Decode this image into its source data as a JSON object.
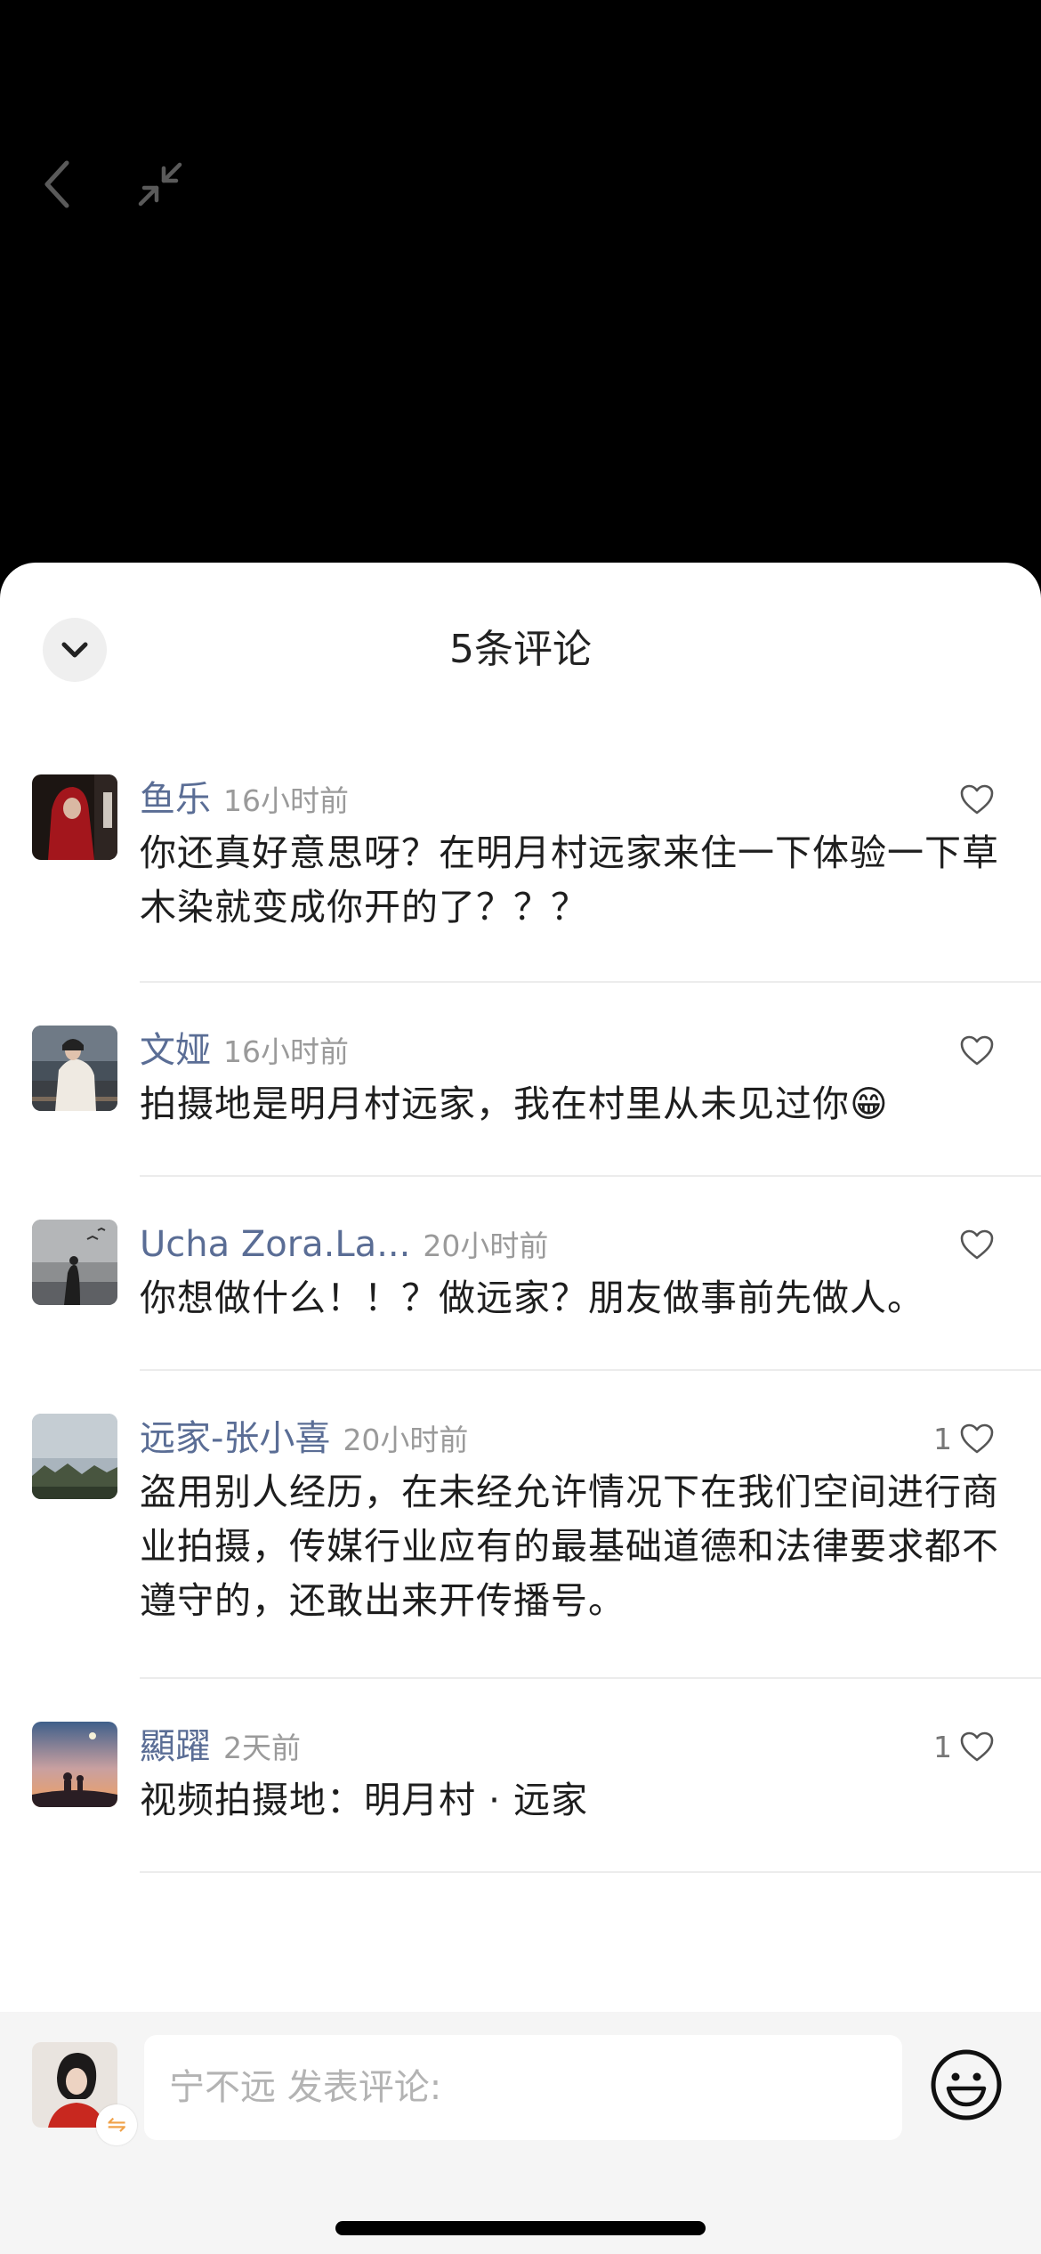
{
  "header": {
    "back_icon": "chevron-left-icon",
    "shrink_icon": "shrink-arrows-icon"
  },
  "sheet": {
    "title": "5条评论",
    "collapse_icon": "chevron-down-icon"
  },
  "comments": [
    {
      "username": "鱼乐",
      "time": "16小时前",
      "likes": "",
      "text": "你还真好意思呀？在明月村远家来住一下体验一下草木染就变成你开的了？？？"
    },
    {
      "username": "文娅",
      "time": "16小时前",
      "likes": "",
      "text": "拍摄地是明月村远家，我在村里从未见过你😁"
    },
    {
      "username": "Ucha Zora.La...",
      "time": "20小时前",
      "likes": "",
      "text": "你想做什么！！？做远家？朋友做事前先做人。"
    },
    {
      "username": "远家-张小喜",
      "time": "20小时前",
      "likes": "1",
      "text": "盗用别人经历，在未经允许情况下在我们空间进行商业拍摄，传媒行业应有的最基础道德和法律要求都不遵守的，还敢出来开传播号。"
    },
    {
      "username": "顯躍",
      "time": "2天前",
      "likes": "1",
      "text": "视频拍摄地：明月村 · 远家"
    }
  ],
  "input": {
    "placeholder": "宁不远 发表评论:",
    "value": "",
    "switch_icon": "switch-arrows-icon",
    "emoji_icon": "smiley-face-icon"
  },
  "colors": {
    "username": "#5a6d95",
    "timestamp": "#9a9a9a",
    "sheet_bg": "#ffffff",
    "input_bar_bg": "#f5f5f5"
  }
}
